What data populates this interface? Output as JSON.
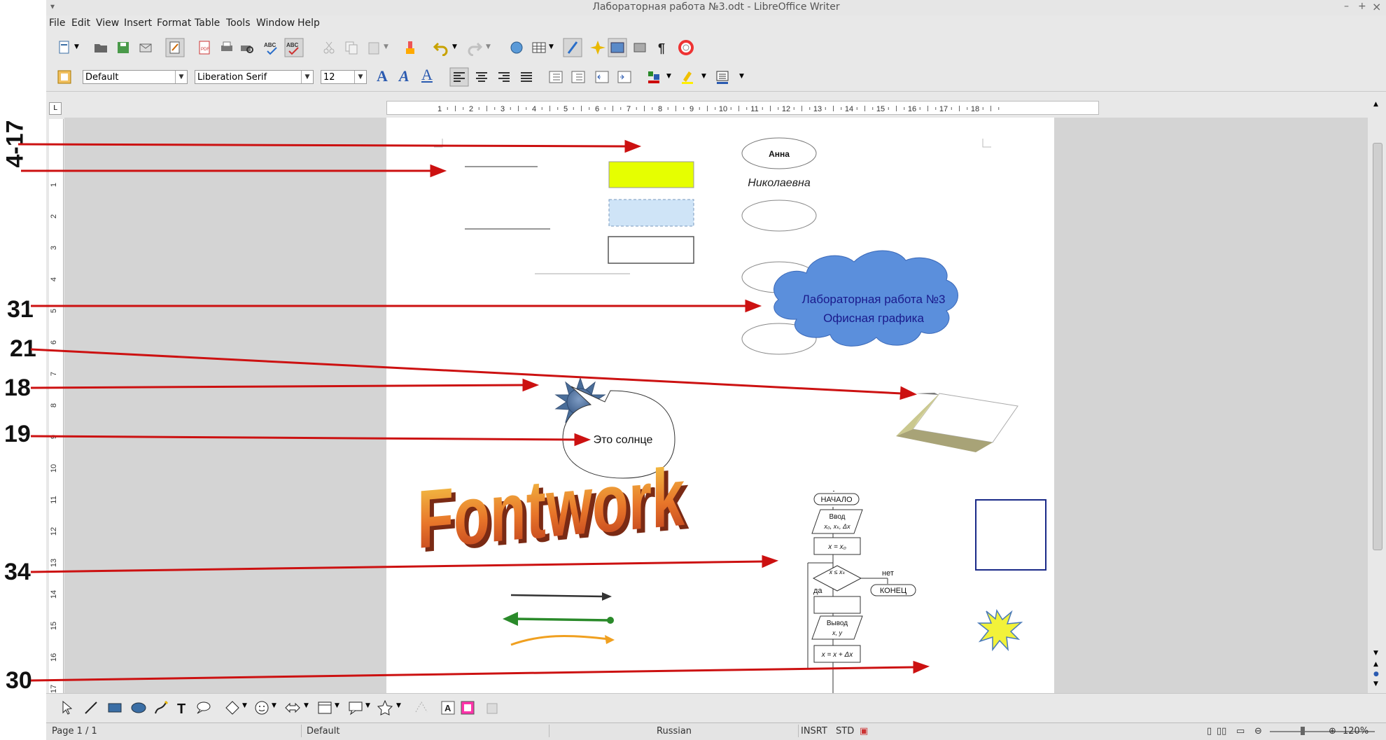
{
  "window": {
    "title": "Лабораторная работа №3.odt - LibreOffice Writer",
    "controls": [
      "–",
      "+",
      "×"
    ]
  },
  "menu": [
    "File",
    "Edit",
    "View",
    "Insert",
    "Format",
    "Table",
    "Tools",
    "Window",
    "Help"
  ],
  "formatting": {
    "style": "Default",
    "font": "Liberation Serif",
    "size": "12"
  },
  "ruler": {
    "h_ticks": [
      "1",
      "2",
      "3",
      "4",
      "5",
      "6",
      "7",
      "8",
      "9",
      "10",
      "11",
      "12",
      "13",
      "14",
      "15",
      "16",
      "17",
      "18"
    ],
    "v_ticks": [
      "1",
      "2",
      "3",
      "4",
      "5",
      "6",
      "7",
      "8",
      "9",
      "10",
      "11",
      "12",
      "13",
      "14",
      "15",
      "16",
      "17"
    ]
  },
  "annotations": [
    "4-17",
    "31",
    "21",
    "18",
    "19",
    "34",
    "30"
  ],
  "document": {
    "oval_name": "Анна",
    "patronymic": "Николаевна",
    "cloud_text": [
      "Лабораторная работа №3",
      "Офисная графика"
    ],
    "callout_text": "Это солнце",
    "fontwork_text": "Fontwork",
    "flowchart": {
      "start": "НАЧАЛО",
      "input": "Ввод",
      "input_vars": "x₀, xₖ, Δx",
      "init": "x = x₀",
      "cond": "x ≤ xₖ",
      "no": "нет",
      "yes": "да",
      "end": "КОНЕЦ",
      "output": "Вывод",
      "output_vars": "x, y",
      "step": "x = x + Δx"
    }
  },
  "status": {
    "page": "Page 1 / 1",
    "style": "Default",
    "language": "Russian",
    "insert": "INSRT",
    "selection": "STD",
    "zoom": "120%"
  },
  "colors": {
    "arrow_red": "#cc1111",
    "cloud_fill": "#5b8fdc",
    "cloud_text": "#1a1a8c",
    "rect_yellow": "#e6ff00",
    "rect_blue": "#cfe4f7",
    "sun_fill": "#4a6e9a",
    "star_fill": "#f2f23a",
    "fontwork_top": "#f5d14a",
    "fontwork_bottom": "#c1401b"
  }
}
